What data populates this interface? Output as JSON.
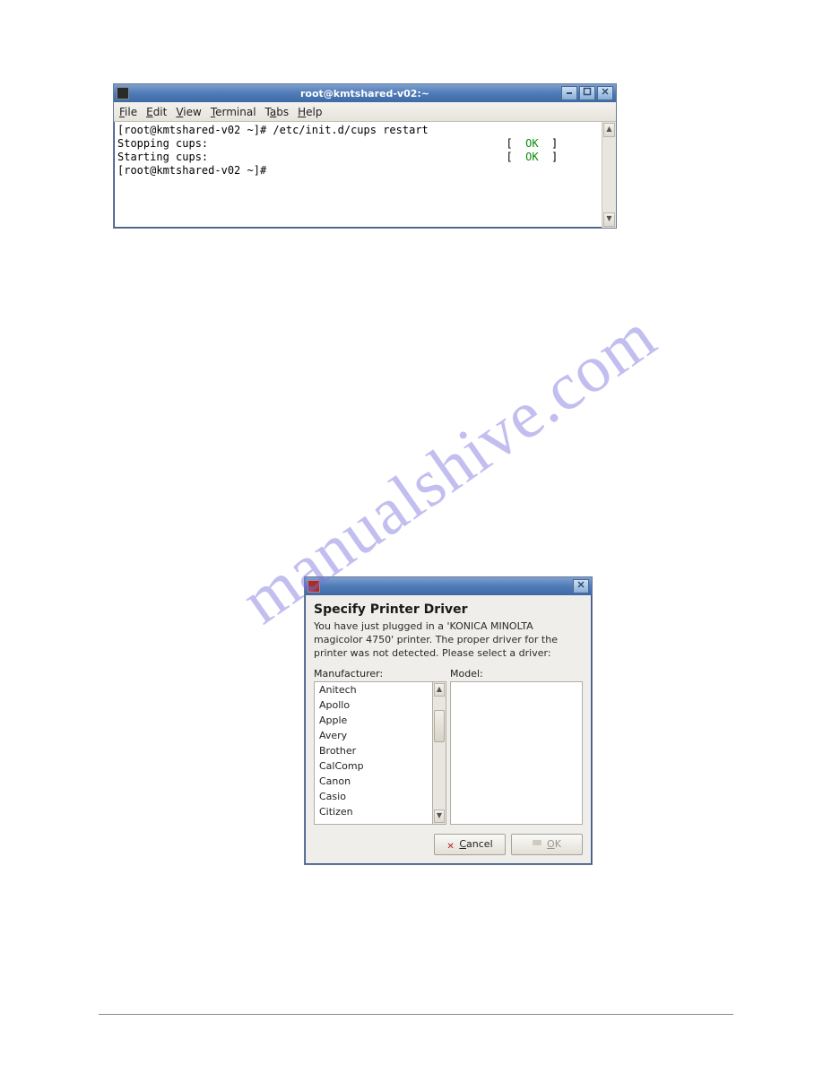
{
  "watermark": "manualshive.com",
  "terminal": {
    "title": "root@kmtshared-v02:~",
    "menus": [
      {
        "label": "File",
        "accel": "F"
      },
      {
        "label": "Edit",
        "accel": "E"
      },
      {
        "label": "View",
        "accel": "V"
      },
      {
        "label": "Terminal",
        "accel": "T"
      },
      {
        "label": "Tabs",
        "accel": "a"
      },
      {
        "label": "Help",
        "accel": "H"
      }
    ],
    "lines": [
      {
        "prompt": "[root@kmtshared-v02 ~]#",
        "cmd": " /etc/init.d/cups restart",
        "status": ""
      },
      {
        "prompt": "Stopping cups:",
        "cmd": "",
        "status": "OK"
      },
      {
        "prompt": "Starting cups:",
        "cmd": "",
        "status": "OK"
      },
      {
        "prompt": "[root@kmtshared-v02 ~]#",
        "cmd": "",
        "status": ""
      }
    ]
  },
  "dialog": {
    "title": "",
    "heading": "Specify Printer Driver",
    "message": "You have just plugged in a 'KONICA MINOLTA magicolor 4750' printer. The proper driver for the printer was not detected. Please select a driver:",
    "manufacturer_label": "Manufacturer:",
    "model_label": "Model:",
    "manufacturers": [
      "Anitech",
      "Apollo",
      "Apple",
      "Avery",
      "Brother",
      "CalComp",
      "Canon",
      "Casio",
      "Citizen"
    ],
    "models": [],
    "cancel_label": "Cancel",
    "ok_label": "OK"
  }
}
